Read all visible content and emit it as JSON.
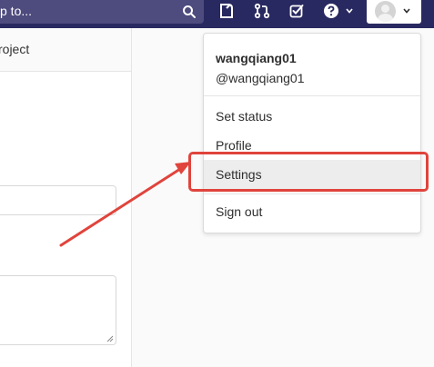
{
  "navbar": {
    "search_placeholder": "p to...",
    "icons": [
      "search-icon",
      "todo-icon",
      "merge-request-icon",
      "issues-icon",
      "help-icon",
      "chevron-down-icon"
    ]
  },
  "left_panel": {
    "project_tab_label": "roject"
  },
  "user_menu": {
    "name": "wangqiang01",
    "handle": "@wangqiang01",
    "items": [
      {
        "label": "Set status"
      },
      {
        "label": "Profile"
      },
      {
        "label": "Settings"
      },
      {
        "label": "Sign out"
      }
    ],
    "highlighted_item": "Settings"
  },
  "annotation": {
    "color": "#e0443c"
  },
  "colors": {
    "navbar": "#292961",
    "search": "#4e4b7e",
    "menu_hover": "#ededed"
  }
}
